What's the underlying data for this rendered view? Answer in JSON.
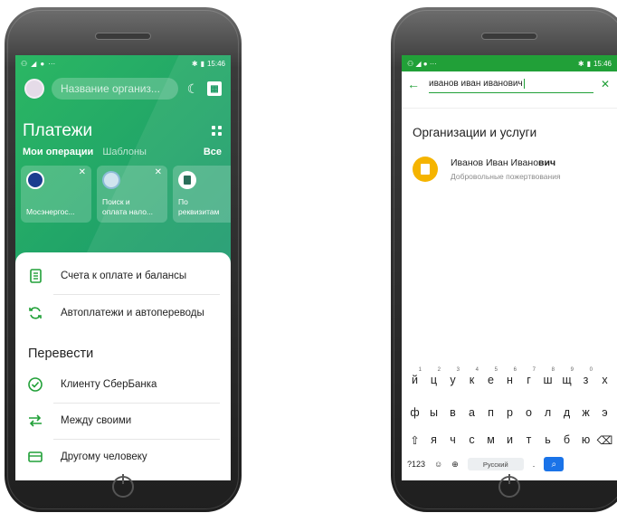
{
  "left": {
    "status": {
      "time": "15:46"
    },
    "search": {
      "placeholder": "Название организ..."
    },
    "payments": {
      "title": "Платежи"
    },
    "tabs": {
      "my_operations": "Мои операции",
      "templates": "Шаблоны",
      "all": "Все"
    },
    "cards": [
      {
        "label": "Мосэнергос..."
      },
      {
        "label_line1": "Поиск и",
        "label_line2": "оплата нало..."
      },
      {
        "label_line1": "По",
        "label_line2": "реквизитам"
      }
    ],
    "menu": {
      "bills": "Счета к оплате и балансы",
      "autopay": "Автоплатежи и автопереводы",
      "transfer_heading": "Перевести",
      "to_sber_client": "Клиенту СберБанка",
      "between_own": "Между своими",
      "to_other_person": "Другому человеку"
    },
    "colors": {
      "brand_green": "#21a038"
    }
  },
  "right": {
    "status": {
      "time": "15:46"
    },
    "search": {
      "value": "иванов иван иванович"
    },
    "section_title": "Организации и услуги",
    "result": {
      "title_prefix": "Иванов Иван Ивано",
      "title_bold": "вич",
      "subtitle": "Добровольные пожертвования"
    },
    "keyboard": {
      "row1": [
        "й",
        "ц",
        "у",
        "к",
        "е",
        "н",
        "г",
        "ш",
        "щ",
        "з",
        "х"
      ],
      "row1_digits": [
        "1",
        "2",
        "3",
        "4",
        "5",
        "6",
        "7",
        "8",
        "9",
        "0",
        ""
      ],
      "row2": [
        "ф",
        "ы",
        "в",
        "а",
        "п",
        "р",
        "о",
        "л",
        "д",
        "ж",
        "э"
      ],
      "row3": [
        "я",
        "ч",
        "с",
        "м",
        "и",
        "т",
        "ь",
        "б",
        "ю"
      ],
      "mode_key": "?123",
      "space_label": "Русский",
      "period": "."
    }
  }
}
